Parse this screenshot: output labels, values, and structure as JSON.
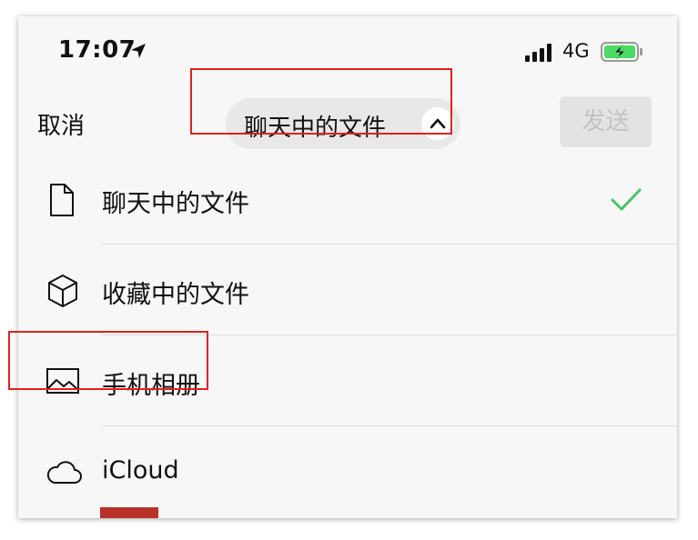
{
  "status_bar": {
    "time": "17:07",
    "network": "4G",
    "location_icon": "location-arrow-icon",
    "signal_icon": "cellular-signal-icon",
    "battery_icon": "battery-charging-icon",
    "battery_color": "#4cd964"
  },
  "header": {
    "cancel_label": "取消",
    "title": "聊天中的文件",
    "title_chevron_icon": "chevron-up-icon",
    "send_label": "发送"
  },
  "menu": {
    "items": [
      {
        "label": "聊天中的文件",
        "icon": "document-icon",
        "selected": true
      },
      {
        "label": "收藏中的文件",
        "icon": "cube-icon",
        "selected": false
      },
      {
        "label": "手机相册",
        "icon": "photo-icon",
        "selected": false
      },
      {
        "label": "iCloud",
        "icon": "cloud-icon",
        "selected": false
      }
    ],
    "check_icon": "checkmark-icon",
    "check_color": "#4cbf6a"
  },
  "annotation_color": "#e02020"
}
